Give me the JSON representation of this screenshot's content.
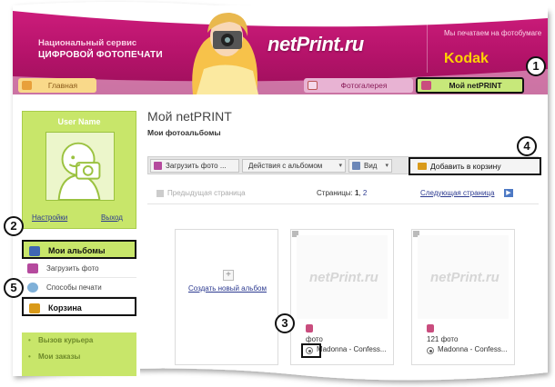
{
  "header": {
    "brand_subtitle": "Национальный сервис",
    "brand_title": "ЦИФРОВОЙ ФОТОПЕЧАТИ",
    "logo": "netPrint.ru",
    "kodak_text": "Мы печатаем на фотобумаге",
    "kodak_logo": "Kodak",
    "tabs": {
      "home": "Главная",
      "gallery": "Фотогалерея",
      "my": "Мой netPRINT"
    }
  },
  "sidebar": {
    "user_name": "User Name",
    "settings_link": "Настройки",
    "exit_link": "Выход",
    "menu": [
      {
        "label": "Мои альбомы",
        "icon": "albums-icon"
      },
      {
        "label": "Загрузить фото",
        "icon": "upload-icon"
      },
      {
        "label": "Способы печати",
        "icon": "print-methods-icon"
      },
      {
        "label": "Корзина",
        "icon": "cart-icon"
      }
    ],
    "secondary_menu": [
      "Вызов курьера",
      "Мои заказы"
    ]
  },
  "main": {
    "title": "Мой netPRINT",
    "subtitle": "Мои фотоальбомы",
    "toolbar": {
      "upload": "Загрузить фото ...",
      "actions": "Действия с альбомом",
      "view": "Вид",
      "add_to_cart": "Добавить в корзину"
    },
    "pager": {
      "prev": "Предыдущая страница",
      "pages_label": "Страницы:",
      "current_page": "1",
      "other_page": "2",
      "next": "Следующая страница"
    },
    "create_album": "Создать новый альбом",
    "albums": [
      {
        "count": "фото",
        "name": "Madonna - Confess..."
      },
      {
        "count": "121 фото",
        "name": "Madonna - Confess..."
      }
    ],
    "thumb_logo": "netPrint.ru"
  },
  "callouts": [
    "1",
    "2",
    "3",
    "4",
    "5"
  ],
  "colors": {
    "header_magenta": "#b5136a",
    "accent_green": "#c8e66a",
    "link_blue": "#2c3a90"
  }
}
